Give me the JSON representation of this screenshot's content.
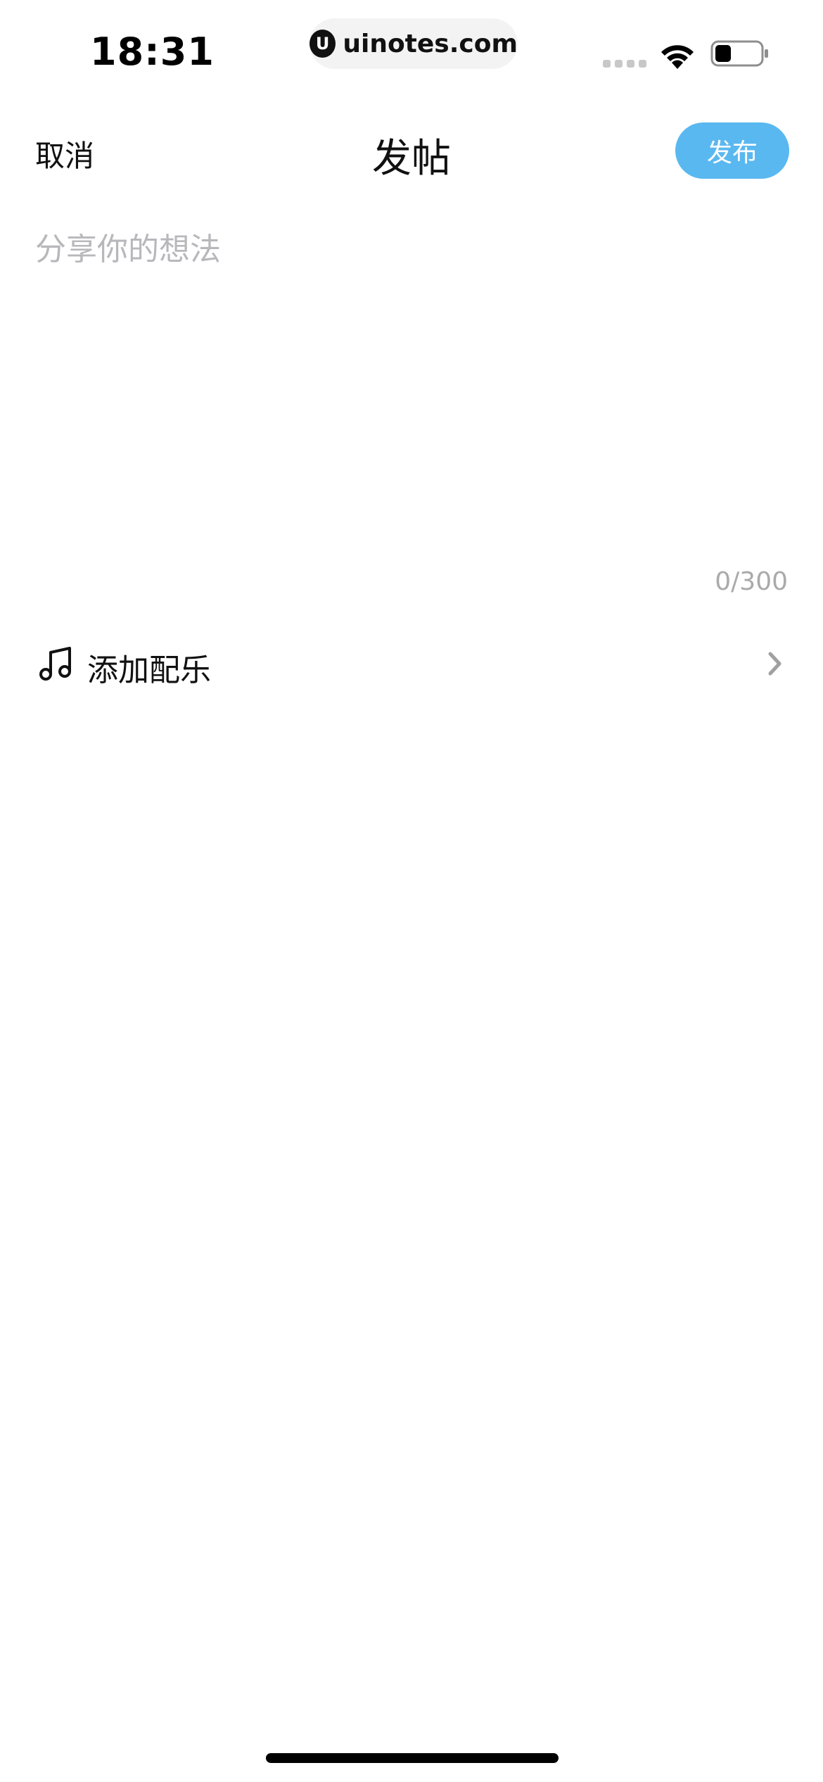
{
  "status_bar": {
    "time": "18:31",
    "url": "uinotes.com",
    "url_logo_glyph": "U",
    "icons": [
      "cellular-signal-icon",
      "wifi-icon",
      "battery-icon"
    ],
    "battery_level": 0.35
  },
  "nav": {
    "cancel_label": "取消",
    "title": "发帖",
    "publish_label": "发布"
  },
  "compose": {
    "placeholder": "分享你的想法",
    "value": "",
    "counter": "0/300"
  },
  "music_row": {
    "label": "添加配乐",
    "icon": "music-note-icon",
    "chevron": "chevron-right-icon"
  },
  "colors": {
    "accent": "#5ab8f0",
    "placeholder": "#b8b8bc",
    "counter": "#aaaaaa",
    "chevron": "#a0a0a0"
  }
}
